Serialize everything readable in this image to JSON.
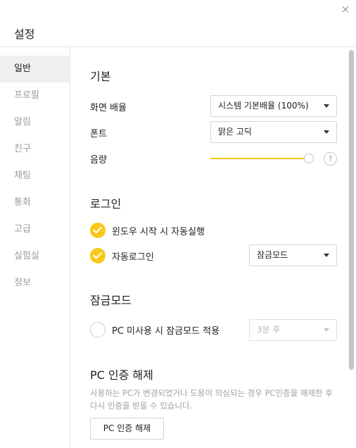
{
  "window": {
    "title": "설정",
    "close_icon": "×"
  },
  "sidebar": {
    "items": [
      {
        "label": "일반",
        "active": true
      },
      {
        "label": "프로필",
        "active": false
      },
      {
        "label": "알림",
        "active": false
      },
      {
        "label": "친구",
        "active": false
      },
      {
        "label": "채팅",
        "active": false
      },
      {
        "label": "통화",
        "active": false
      },
      {
        "label": "고급",
        "active": false
      },
      {
        "label": "실험실",
        "active": false
      },
      {
        "label": "정보",
        "active": false
      }
    ]
  },
  "basic": {
    "title": "기본",
    "scale_label": "화면 배율",
    "scale_value": "시스템 기본배율 (100%)",
    "font_label": "폰트",
    "font_value": "맑은 고딕",
    "volume_label": "음량",
    "volume_level": 1.0,
    "help_icon": "?"
  },
  "login": {
    "title": "로그인",
    "autostart_label": "윈도우 시작 시 자동실행",
    "autostart_checked": true,
    "autologin_label": "자동로그인",
    "autologin_checked": true,
    "autologin_mode": "잠금모드"
  },
  "lock": {
    "title": "잠금모드",
    "idle_label": "PC 미사용 시 잠금모드 적용",
    "idle_checked": false,
    "idle_time": "3분 후"
  },
  "pc_auth": {
    "title": "PC 인증 해제",
    "description": "사용하는 PC가 변경되었거나 도용이 의심되는 경우 PC인증을 해제한 후 다시 인증을 받을 수 있습니다.",
    "button_label": "PC 인증 해제"
  },
  "colors": {
    "accent": "#f9c919",
    "muted_text": "#9b9b9b",
    "active_bg": "#efefef"
  }
}
